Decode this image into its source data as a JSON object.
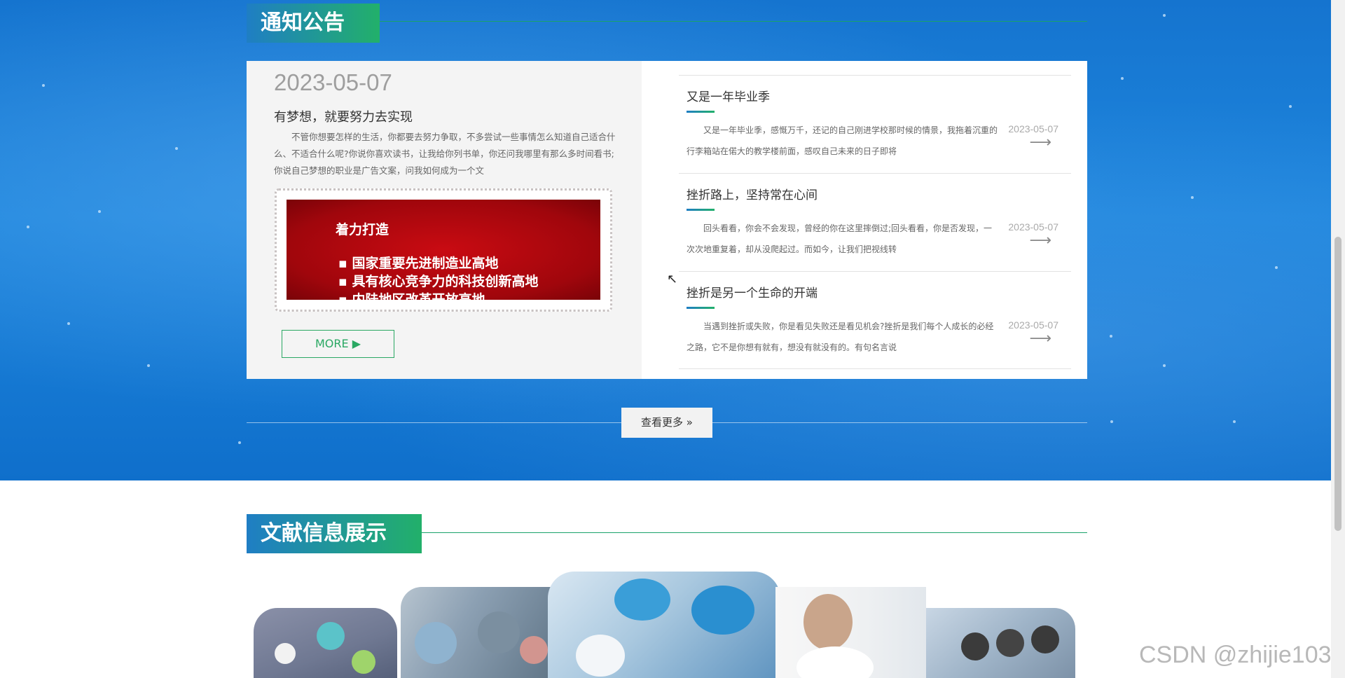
{
  "notice_section": {
    "title": "通知公告",
    "featured": {
      "date": "2023-05-07",
      "title": "有梦想，就要努力去实现",
      "text": "不管你想要怎样的生活，你都要去努力争取，不多尝试一些事情怎么知道自己适合什么、不适合什么呢?你说你喜欢读书，让我给你列书单，你还问我哪里有那么多时间看书;你说自己梦想的职业是广告文案，问我如何成为一个文",
      "image_heading": "着力打造",
      "image_items": [
        "国家重要先进制造业高地",
        "具有核心竞争力的科技创新高地",
        "内陆地区改革开放高地"
      ],
      "more_label": "MORE ▶"
    },
    "items": [
      {
        "title": "又是一年毕业季",
        "text": "又是一年毕业季，感慨万千，还记的自己刚进学校那时候的情景，我拖着沉重的行李箱站在偌大的教学楼前面，感叹自己未来的日子即将",
        "date": "2023-05-07"
      },
      {
        "title": "挫折路上，坚持常在心间",
        "text": "回头看看，你会不会发现，曾经的你在这里摔倒过;回头看看，你是否发现，一次次地重复着，却从没爬起过。而如今，让我们把视线转",
        "date": "2023-05-07"
      },
      {
        "title": "挫折是另一个生命的开端",
        "text": "当遇到挫折或失败，你是看见失败还是看见机会?挫折是我们每个人成长的必经之路，它不是你想有就有，想没有就没有的。有句名言说",
        "date": "2023-05-07"
      }
    ],
    "see_more_label": "查看更多 »"
  },
  "docs_section": {
    "title": "文献信息展示"
  },
  "watermark": "CSDN @zhijie103",
  "colors": {
    "accent_green": "#2aa863",
    "title_gradient_start": "#1f7ec4",
    "title_gradient_end": "#22b06a",
    "band_blue": "#1574cf"
  }
}
